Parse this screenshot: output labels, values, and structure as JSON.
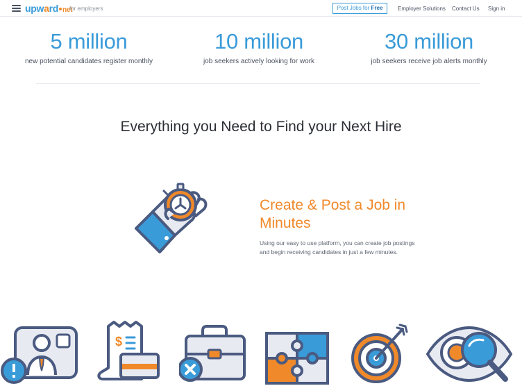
{
  "header": {
    "logo_part1": "upw",
    "logo_part2": "rd",
    "logo_net": "net",
    "tagline": "for employers",
    "post_jobs_label": "Post Jobs for",
    "post_jobs_emphasis": "Free",
    "nav": [
      "Employer Solutions",
      "Contact Us",
      "Sign in"
    ]
  },
  "stats": [
    {
      "number": "5 million",
      "description": "new potential candidates register monthly"
    },
    {
      "number": "10 million",
      "description": "job seekers actively looking for work"
    },
    {
      "number": "30 million",
      "description": "job seekers receive job alerts monthly"
    }
  ],
  "headline": "Everything you Need to Find your Next Hire",
  "feature": {
    "title": "Create & Post a Job in Minutes",
    "text": "Using our easy to use platform, you can create job postings and begin receiving candidates in just a few minutes."
  },
  "icons": {
    "hero": "hand-stopwatch-icon",
    "bottom": [
      "candidate-profile-alert-icon",
      "receipt-payment-icon",
      "briefcase-cancel-icon",
      "puzzle-icon",
      "target-arrow-icon",
      "eye-magnifier-icon"
    ]
  },
  "colors": {
    "primary_blue": "#3a9bd9",
    "accent_orange": "#f0892a",
    "outline_navy": "#4a5a80",
    "text_dark": "#2c2f36"
  }
}
